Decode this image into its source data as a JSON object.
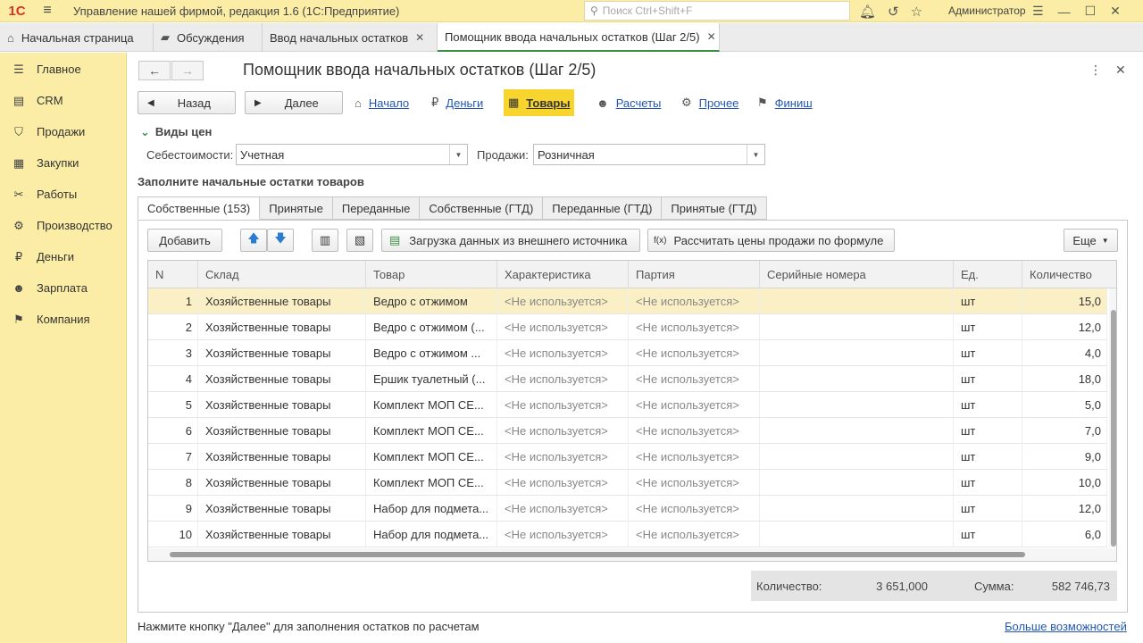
{
  "app": {
    "logo": "1С",
    "title": "Управление нашей фирмой, редакция 1.6  (1С:Предприятие)",
    "search_placeholder": "Поиск Ctrl+Shift+F",
    "user": "Администратор"
  },
  "tabs": [
    {
      "label": "Начальная страница",
      "icon": "home-icon"
    },
    {
      "label": "Обсуждения",
      "icon": "chat-icon"
    },
    {
      "label": "Ввод начальных остатков",
      "closable": true
    },
    {
      "label": "Помощник ввода начальных остатков (Шаг 2/5)",
      "closable": true,
      "active": true
    }
  ],
  "sidebar": {
    "items": [
      {
        "label": "Главное",
        "icon": "menu-list-icon"
      },
      {
        "label": "CRM",
        "icon": "contact-card-icon"
      },
      {
        "label": "Продажи",
        "icon": "basket-icon"
      },
      {
        "label": "Закупки",
        "icon": "cart-icon"
      },
      {
        "label": "Работы",
        "icon": "tools-icon"
      },
      {
        "label": "Производство",
        "icon": "factory-icon"
      },
      {
        "label": "Деньги",
        "icon": "ruble-icon"
      },
      {
        "label": "Зарплата",
        "icon": "people-icon"
      },
      {
        "label": "Компания",
        "icon": "flag-icon"
      }
    ]
  },
  "form": {
    "title": "Помощник ввода начальных остатков (Шаг 2/5)",
    "back_label": "Назад",
    "next_label": "Далее",
    "wizard_steps": [
      {
        "label": "Начало",
        "icon": "home-icon"
      },
      {
        "label": "Деньги",
        "icon": "ruble-icon"
      },
      {
        "label": "Товары",
        "icon": "cart-icon",
        "active": true
      },
      {
        "label": "Расчеты",
        "icon": "person-icon"
      },
      {
        "label": "Прочее",
        "icon": "gear-icon"
      },
      {
        "label": "Финиш",
        "icon": "flag-icon"
      }
    ],
    "price_section": "Виды цен",
    "cost_label": "Себестоимости:",
    "cost_value": "Учетная",
    "sales_label": "Продажи:",
    "sales_value": "Розничная",
    "fill_section": "Заполните начальные остатки товаров",
    "inner_tabs": [
      "Собственные (153)",
      "Принятые",
      "Переданные",
      "Собственные (ГТД)",
      "Переданные (ГТД)",
      "Принятые (ГТД)"
    ],
    "toolbar": {
      "add_label": "Добавить",
      "load_label": "Загрузка данных из внешнего источника",
      "calc_label": "Рассчитать цены продажи по формуле",
      "more_label": "Еще"
    },
    "table": {
      "columns": [
        "N",
        "Склад",
        "Товар",
        "Характеристика",
        "Партия",
        "Серийные номера",
        "Ед.",
        "Количество"
      ],
      "rows": [
        [
          "1",
          "Хозяйственные товары",
          "Ведро с отжимом",
          "<Не используется>",
          "<Не используется>",
          "",
          "шт",
          "15,0"
        ],
        [
          "2",
          "Хозяйственные товары",
          "Ведро с отжимом (...",
          "<Не используется>",
          "<Не используется>",
          "",
          "шт",
          "12,0"
        ],
        [
          "3",
          "Хозяйственные товары",
          "Ведро с отжимом  ...",
          "<Не используется>",
          "<Не используется>",
          "",
          "шт",
          "4,0"
        ],
        [
          "4",
          "Хозяйственные товары",
          "Ершик туалетный (...",
          "<Не используется>",
          "<Не используется>",
          "",
          "шт",
          "18,0"
        ],
        [
          "5",
          "Хозяйственные товары",
          "Комплект МОП СЕ...",
          "<Не используется>",
          "<Не используется>",
          "",
          "шт",
          "5,0"
        ],
        [
          "6",
          "Хозяйственные товары",
          "Комплект МОП СЕ...",
          "<Не используется>",
          "<Не используется>",
          "",
          "шт",
          "7,0"
        ],
        [
          "7",
          "Хозяйственные товары",
          "Комплект МОП СЕ...",
          "<Не используется>",
          "<Не используется>",
          "",
          "шт",
          "9,0"
        ],
        [
          "8",
          "Хозяйственные товары",
          "Комплект МОП СЕ...",
          "<Не используется>",
          "<Не используется>",
          "",
          "шт",
          "10,0"
        ],
        [
          "9",
          "Хозяйственные товары",
          "Набор для подмета...",
          "<Не используется>",
          "<Не используется>",
          "",
          "шт",
          "12,0"
        ],
        [
          "10",
          "Хозяйственные товары",
          "Набор для подмета...",
          "<Не используется>",
          "<Не используется>",
          "",
          "шт",
          "6,0"
        ]
      ]
    },
    "totals": {
      "qty_label": "Количество:",
      "qty_value": "3 651,000",
      "sum_label": "Сумма:",
      "sum_value": "582 746,73"
    },
    "hint": "Нажмите кнопку \"Далее\" для заполнения остатков по расчетам",
    "more_link": "Больше возможностей"
  },
  "colors": {
    "accent_yellow": "#fbeda5",
    "active_step": "#f7d52e",
    "link": "#2456b5",
    "selected_row": "#fbefc5"
  }
}
